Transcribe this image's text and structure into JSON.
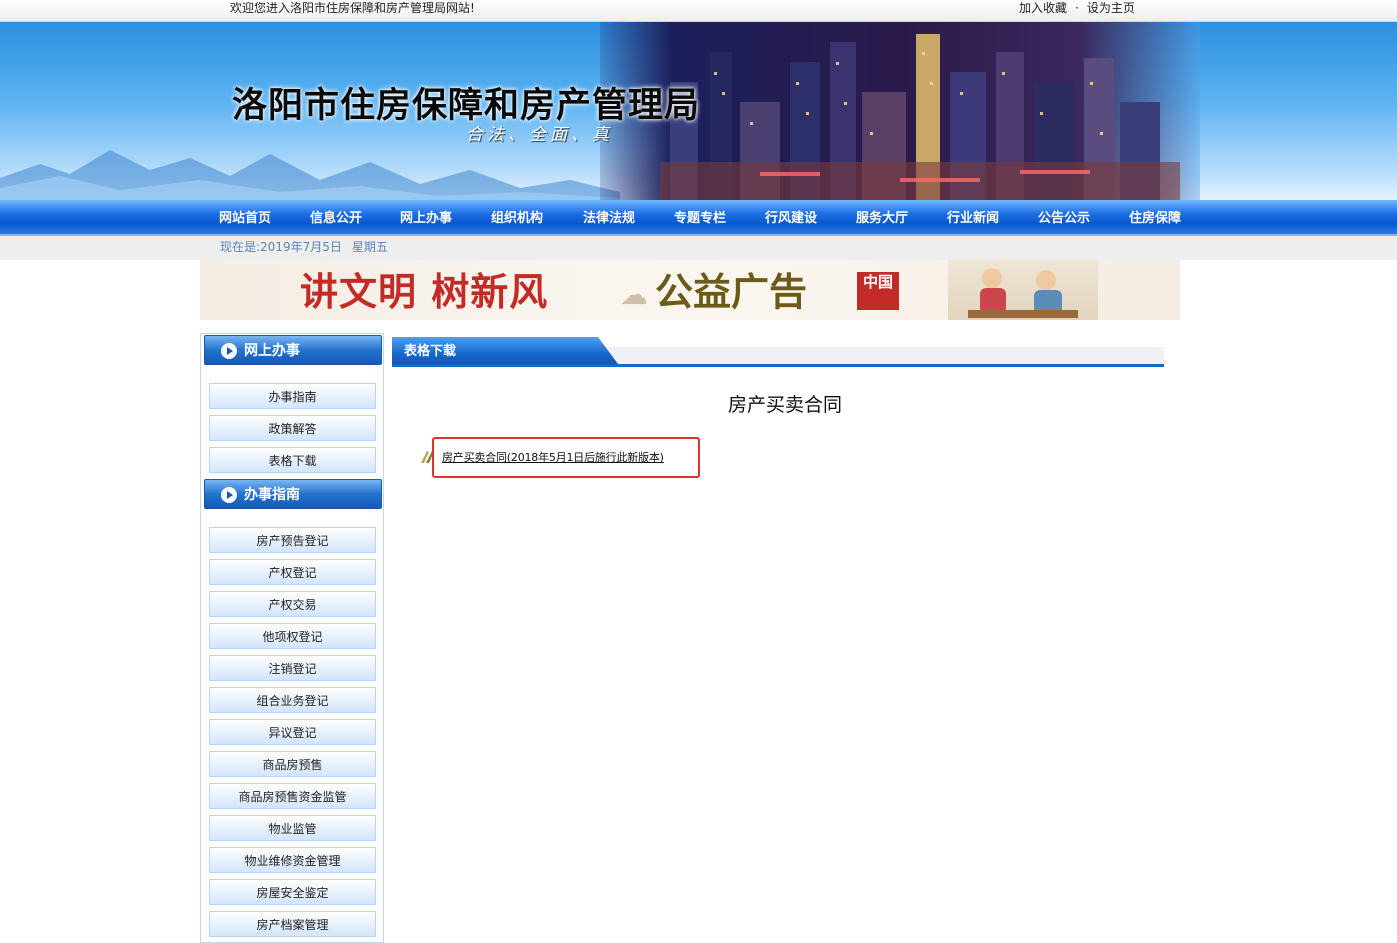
{
  "topbar": {
    "welcome": "欢迎您进入洛阳市住房保障和房产管理局网站!",
    "bookmark": "加入收藏",
    "separator": "·",
    "homepage": "设为主页"
  },
  "banner": {
    "title": "洛阳市住房保障和房产管理局",
    "motto": "合法、全面、真"
  },
  "nav": {
    "items": [
      "网站首页",
      "信息公开",
      "网上办事",
      "组织机构",
      "法律法规",
      "专题专栏",
      "行风建设",
      "服务大厅",
      "行业新闻",
      "公告公示",
      "住房保障"
    ]
  },
  "datebar": {
    "date": "现在是:2019年7月5日",
    "weekday": "星期五"
  },
  "ad": {
    "slogan_red": "讲文明 树新风",
    "slogan_gold": "公益广告",
    "seal_text": "中国"
  },
  "sidebar": {
    "online_title": "网上办事",
    "online_items": [
      "办事指南",
      "政策解答",
      "表格下载"
    ],
    "guide_title": "办事指南",
    "guide_items": [
      "房产预告登记",
      "产权登记",
      "产权交易",
      "他项权登记",
      "注销登记",
      "组合业务登记",
      "异议登记",
      "商品房预售",
      "商品房预售资金监管",
      "物业监管",
      "物业维修资金管理",
      "房屋安全鉴定",
      "房产档案管理"
    ]
  },
  "main": {
    "tab_title": "表格下载",
    "heading": "房产买卖合同",
    "download_link": "房产买卖合同(2018年5月1日后施行此新版本)"
  },
  "colors": {
    "nav_blue": "#0a56cc",
    "highlight_border": "#e0322b",
    "date_text": "#5a84b8",
    "ad_red": "#c42a26"
  }
}
